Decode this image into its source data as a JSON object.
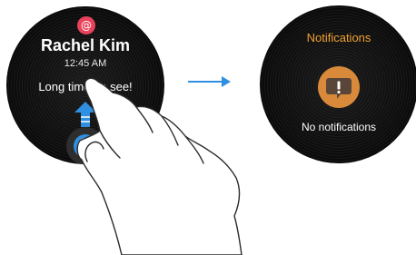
{
  "left_watch": {
    "app_icon": "at-sign-icon",
    "app_icon_glyph": "@",
    "sender": "Rachel Kim",
    "time": "12:45 AM",
    "message": "Long time no see!"
  },
  "right_watch": {
    "title": "Notifications",
    "empty_text": "No notifications",
    "icon": "alert-bubble-icon"
  },
  "colors": {
    "notification_accent": "#f0a030",
    "app_badge": "#e8435b",
    "transition_arrow": "#2f8fe0",
    "reply_handle": "#2f8fe0"
  }
}
